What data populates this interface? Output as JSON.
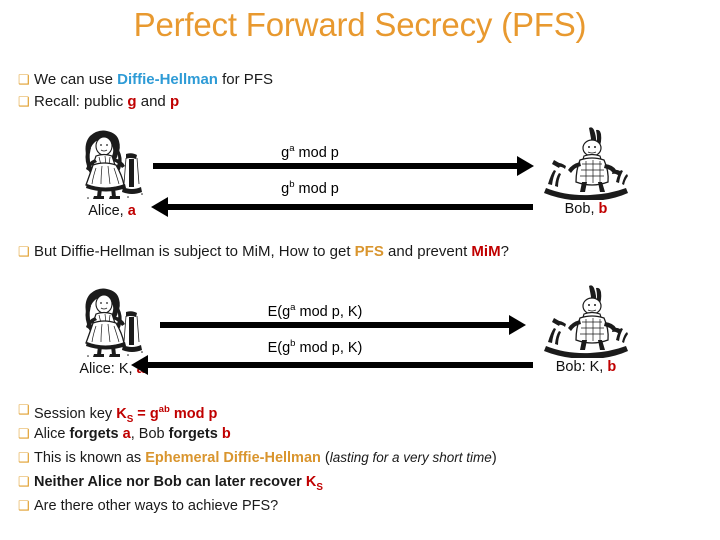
{
  "slide": {
    "title": "Perfect Forward Secrecy (PFS)",
    "title_color": "#E8992F",
    "background": "#ffffff"
  },
  "colors": {
    "accent_orange": "#D9952E",
    "link_blue": "#2E9BD6",
    "highlight_red": "#C00000",
    "bullet_marker": "#E0A030",
    "arrow": "#000000"
  },
  "top_bullets": [
    {
      "marker": "❑",
      "parts": [
        {
          "text": "We can use ",
          "style": "plain"
        },
        {
          "text": "Diffie-Hellman",
          "style": "blue"
        },
        {
          "text": " for PFS",
          "style": "plain"
        }
      ]
    },
    {
      "marker": "❑",
      "parts": [
        {
          "text": "Recall: public ",
          "style": "plain"
        },
        {
          "text": "g",
          "style": "red"
        },
        {
          "text": " and ",
          "style": "plain"
        },
        {
          "text": "p",
          "style": "red"
        }
      ]
    }
  ],
  "diagram_1": {
    "left_actor": {
      "name": "alice",
      "figure": "alice-engraving",
      "label_prefix": "Alice, ",
      "label_secret": "a"
    },
    "right_actor": {
      "name": "bob",
      "figure": "white-rabbit-engraving",
      "label_prefix": "Bob, ",
      "label_secret": "b"
    },
    "messages": [
      {
        "base": "g",
        "exp": "a",
        "rest": " mod p",
        "direction": "right"
      },
      {
        "base": "g",
        "exp": "b",
        "rest": " mod p",
        "direction": "left"
      }
    ]
  },
  "middle_bullet": {
    "marker": "❑",
    "parts": [
      {
        "text": "But Diffie-Hellman is subject to MiM, How to get ",
        "style": "plain"
      },
      {
        "text": "PFS",
        "style": "orange"
      },
      {
        "text": " and prevent ",
        "style": "plain"
      },
      {
        "text": "MiM",
        "style": "red"
      },
      {
        "text": "?",
        "style": "plain"
      }
    ]
  },
  "diagram_2": {
    "left_actor": {
      "name": "alice",
      "figure": "alice-engraving",
      "label_prefix": "Alice: K, ",
      "label_secret": "a"
    },
    "right_actor": {
      "name": "bob",
      "figure": "white-rabbit-engraving",
      "label_prefix": "Bob: K, ",
      "label_secret": "b"
    },
    "messages": [
      {
        "prefix": "E(",
        "base": "g",
        "exp": "a",
        "rest": " mod p, K)",
        "direction": "right"
      },
      {
        "prefix": "E(",
        "base": "g",
        "exp": "b",
        "rest": " mod p, K)",
        "direction": "left"
      }
    ]
  },
  "bottom_bullets": [
    {
      "marker": "❑",
      "parts": [
        {
          "text": "Session key ",
          "style": "plain"
        },
        {
          "text": "K",
          "style": "red",
          "sub": "S"
        },
        {
          "text": "  =  ",
          "style": "red"
        },
        {
          "text": "g",
          "style": "red",
          "sup": "ab"
        },
        {
          "text": "  mod  p",
          "style": "red"
        }
      ]
    },
    {
      "marker": "❑",
      "parts": [
        {
          "text": "Alice ",
          "style": "plain"
        },
        {
          "text": "forgets",
          "style": "bold"
        },
        {
          "text": " ",
          "style": "plain"
        },
        {
          "text": "a",
          "style": "red"
        },
        {
          "text": ", Bob ",
          "style": "plain"
        },
        {
          "text": "forgets",
          "style": "bold"
        },
        {
          "text": " ",
          "style": "plain"
        },
        {
          "text": "b",
          "style": "red"
        }
      ]
    },
    {
      "marker": "❑",
      "parts": [
        {
          "text": "This is known as ",
          "style": "plain"
        },
        {
          "text": "Ephemeral Diffie-Hellman",
          "style": "orange"
        },
        {
          "text": " (",
          "style": "plain"
        },
        {
          "text": "lasting for a very short time",
          "style": "italic"
        },
        {
          "text": ")",
          "style": "plain"
        }
      ]
    },
    {
      "marker": "❑",
      "parts": [
        {
          "text": "Neither Alice nor Bob can later recover ",
          "style": "bold"
        },
        {
          "text": "K",
          "style": "red",
          "sub": "S"
        }
      ]
    },
    {
      "marker": "❑",
      "parts": [
        {
          "text": "Are there other ways to achieve PFS?",
          "style": "plain"
        }
      ]
    }
  ]
}
